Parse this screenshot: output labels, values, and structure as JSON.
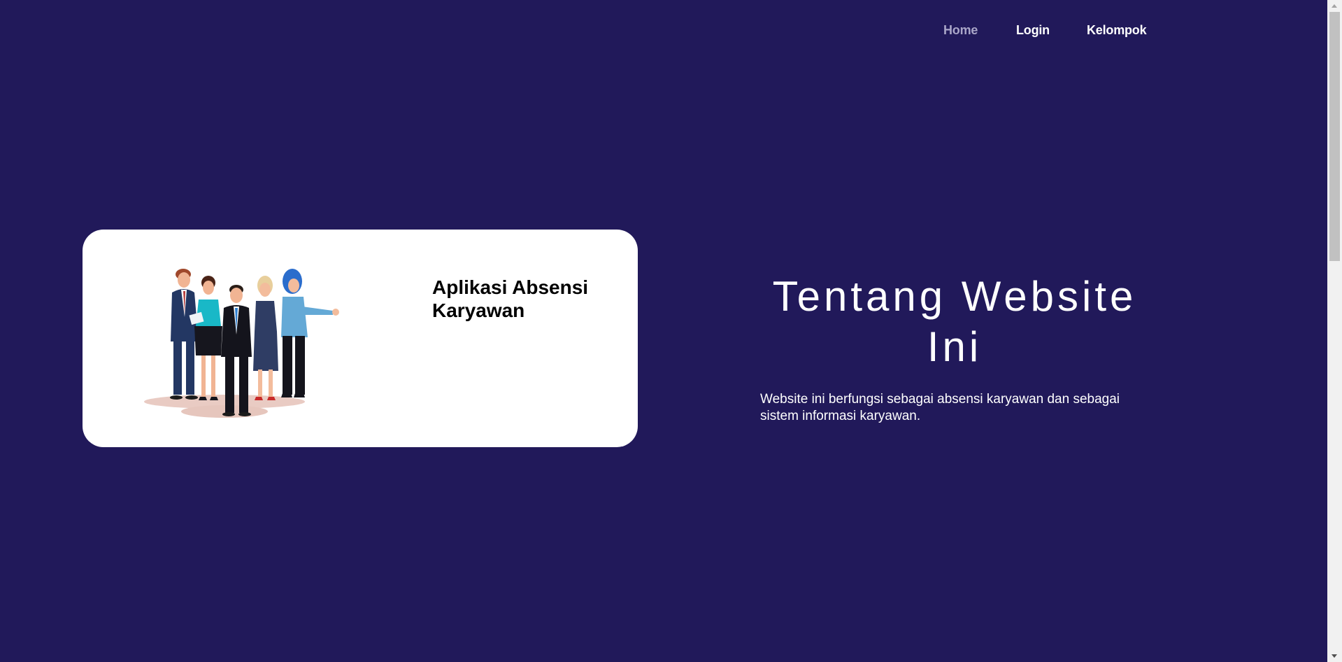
{
  "nav": {
    "items": [
      {
        "label": "Home",
        "active": true
      },
      {
        "label": "Login",
        "active": false
      },
      {
        "label": "Kelompok",
        "active": false
      }
    ]
  },
  "card": {
    "title": "Aplikasi Absensi Karyawan",
    "illustration": "business-team-illustration"
  },
  "about": {
    "title": "Tentang Website Ini",
    "description": "Website ini berfungsi sebagai absensi karyawan dan sebagai sistem informasi karyawan."
  },
  "colors": {
    "background": "#21195a",
    "card": "#ffffff",
    "text": "#ffffff",
    "nav_active": "#aaa6c8"
  }
}
